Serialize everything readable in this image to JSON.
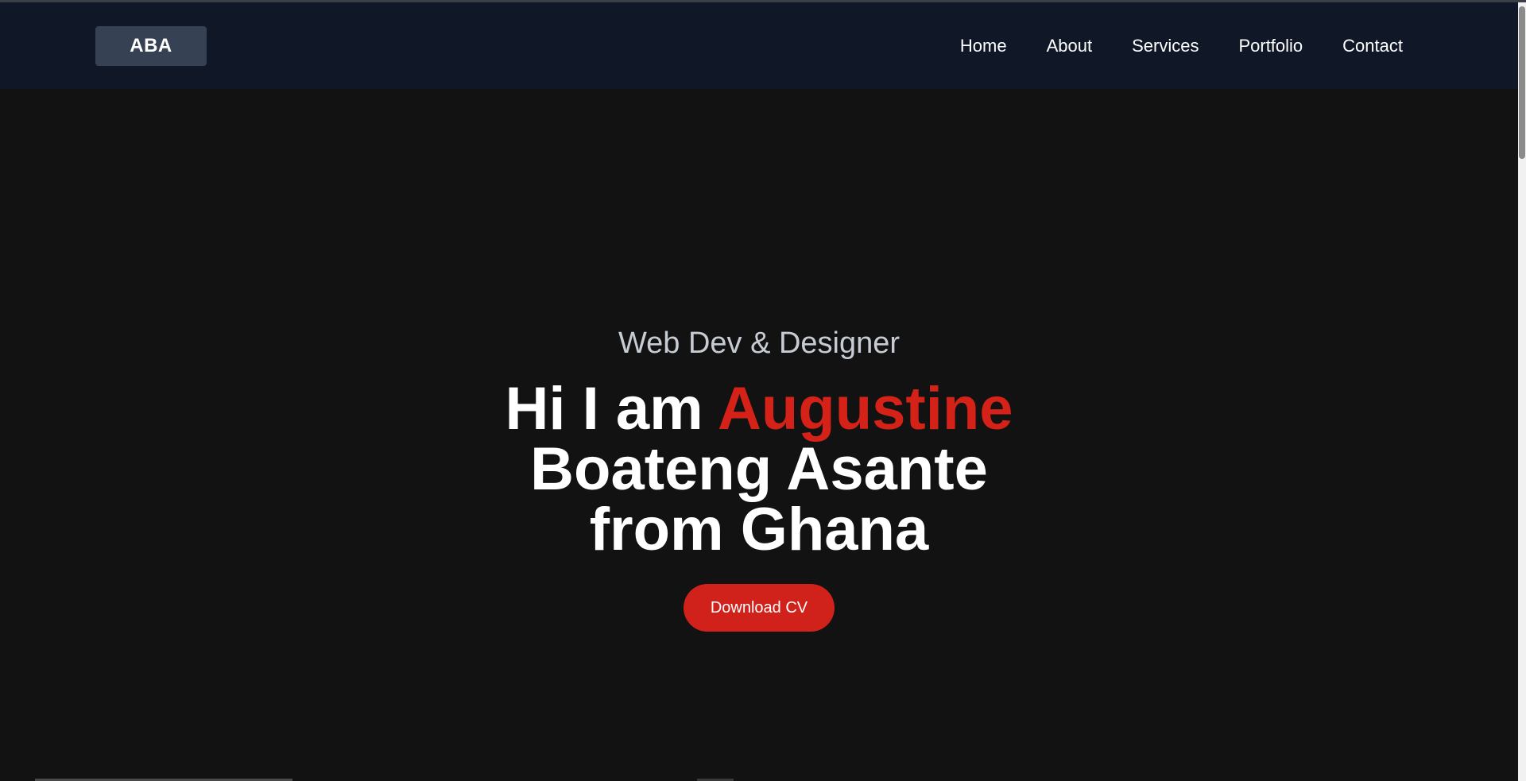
{
  "header": {
    "logo": "ABA",
    "nav": [
      {
        "label": "Home"
      },
      {
        "label": "About"
      },
      {
        "label": "Services"
      },
      {
        "label": "Portfolio"
      },
      {
        "label": "Contact"
      }
    ]
  },
  "hero": {
    "subtitle": "Web Dev & Designer",
    "headline_prefix": "Hi I am ",
    "headline_accent": "Augustine",
    "headline_line2": "Boateng Asante",
    "headline_line3": "from Ghana",
    "cta_label": "Download CV"
  },
  "colors": {
    "page_background": "#121212",
    "navbar_background": "#101828",
    "logo_background": "#364153",
    "accent": "#d52218",
    "button": "#d0221a",
    "subtitle_text": "#c7ccd4"
  }
}
